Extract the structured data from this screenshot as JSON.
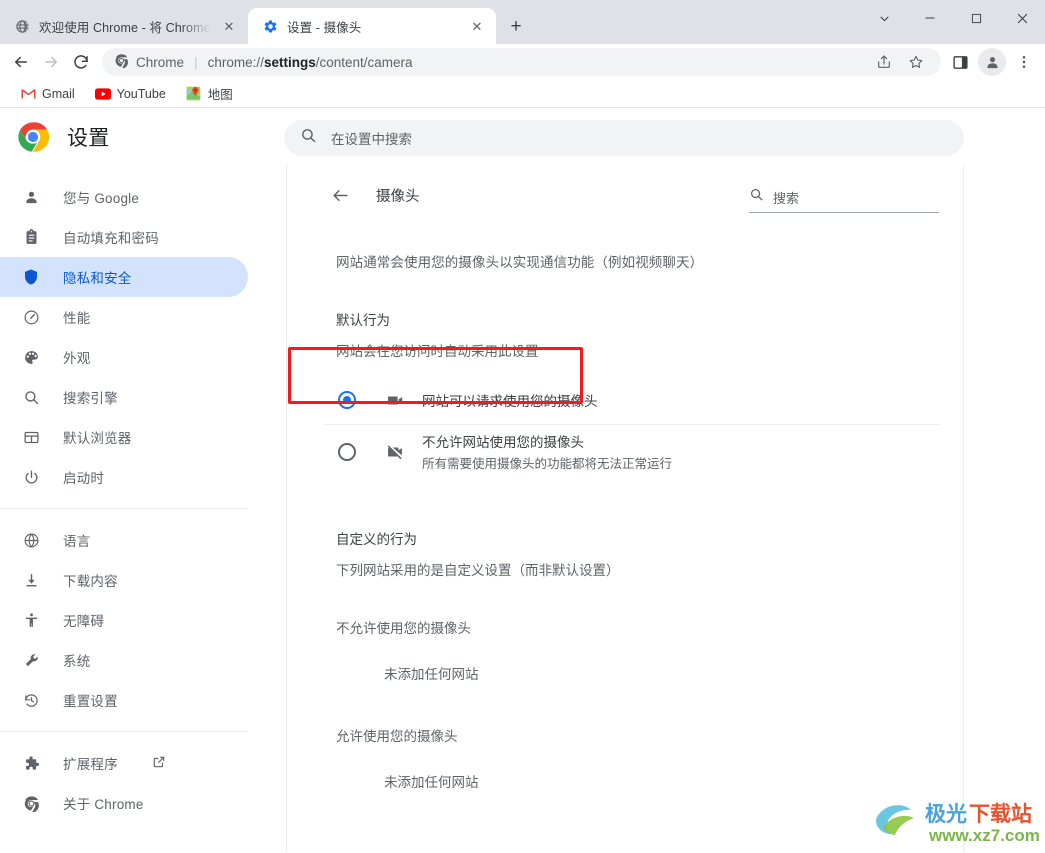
{
  "window": {
    "controls": [
      {
        "name": "tab-search-button",
        "glyph": "⌄"
      },
      {
        "name": "minimize-button",
        "glyph": "—"
      },
      {
        "name": "maximize-button",
        "glyph": "□"
      },
      {
        "name": "close-button",
        "glyph": "✕"
      }
    ]
  },
  "tabs": [
    {
      "title": "欢迎使用 Chrome - 将 Chrome",
      "favicon": "globe-icon",
      "active": false,
      "close_label": "✕"
    },
    {
      "title": "设置 - 摄像头",
      "favicon": "gear-icon",
      "active": true,
      "close_label": "✕"
    }
  ],
  "new_tab_label": "+",
  "toolbar": {
    "back_label": "←",
    "forward_label": "→",
    "reload_label": "⟳",
    "omnibox": {
      "chip_label": "Chrome",
      "separator": "|",
      "url_prefix": "chrome://",
      "url_bold": "settings",
      "url_suffix": "/content/camera"
    },
    "share_name": "share-icon",
    "bookmark_name": "star-icon",
    "sidepanel_name": "side-panel-icon",
    "profile_name": "profile-avatar",
    "menu_name": "three-dot-menu-icon"
  },
  "bookmarks": [
    {
      "label": "Gmail",
      "icon": "gmail-icon"
    },
    {
      "label": "YouTube",
      "icon": "youtube-icon"
    },
    {
      "label": "地图",
      "icon": "google-maps-icon"
    }
  ],
  "settings_header": {
    "title": "设置",
    "logo": "chrome-logo",
    "search_placeholder": "在设置中搜索"
  },
  "sidebar": {
    "group1": [
      {
        "label": "您与 Google",
        "icon": "person-icon",
        "selected": false
      },
      {
        "label": "自动填充和密码",
        "icon": "clipboard-icon",
        "selected": false
      },
      {
        "label": "隐私和安全",
        "icon": "shield-icon",
        "selected": true
      },
      {
        "label": "性能",
        "icon": "speedometer-icon",
        "selected": false
      },
      {
        "label": "外观",
        "icon": "palette-icon",
        "selected": false
      },
      {
        "label": "搜索引擎",
        "icon": "search-icon",
        "selected": false
      },
      {
        "label": "默认浏览器",
        "icon": "browser-window-icon",
        "selected": false
      },
      {
        "label": "启动时",
        "icon": "power-icon",
        "selected": false
      }
    ],
    "group2": [
      {
        "label": "语言",
        "icon": "globe-icon",
        "selected": false
      },
      {
        "label": "下载内容",
        "icon": "download-icon",
        "selected": false
      },
      {
        "label": "无障碍",
        "icon": "accessibility-icon",
        "selected": false
      },
      {
        "label": "系统",
        "icon": "wrench-icon",
        "selected": false
      },
      {
        "label": "重置设置",
        "icon": "history-restore-icon",
        "selected": false
      }
    ],
    "group3": [
      {
        "label": "扩展程序",
        "icon": "puzzle-icon",
        "external": true,
        "selected": false
      },
      {
        "label": "关于 Chrome",
        "icon": "chrome-icon",
        "selected": false
      }
    ]
  },
  "content": {
    "back_label": "←",
    "title": "摄像头",
    "search_placeholder": "搜索",
    "description": "网站通常会使用您的摄像头以实现通信功能（例如视频聊天）",
    "default_behavior_label": "默认行为",
    "default_behavior_sub": "网站会在您访问时自动采用此设置",
    "options": [
      {
        "title": "网站可以请求使用您的摄像头",
        "subtitle": "",
        "icon": "videocam-icon",
        "selected": true,
        "highlighted": true
      },
      {
        "title": "不允许网站使用您的摄像头",
        "subtitle": "所有需要使用摄像头的功能都将无法正常运行",
        "icon": "videocam-off-icon",
        "selected": false,
        "highlighted": false
      }
    ],
    "custom_behavior_label": "自定义的行为",
    "custom_behavior_sub": "下列网站采用的是自定义设置（而非默认设置）",
    "custom_groups": [
      {
        "title": "不允许使用您的摄像头",
        "empty_text": "未添加任何网站"
      },
      {
        "title": "允许使用您的摄像头",
        "empty_text": "未添加任何网站"
      }
    ]
  },
  "watermark": {
    "title": "极光下载站",
    "url": "www.xz7.com"
  },
  "colors": {
    "accent_blue": "#1a73e8",
    "selected_nav_bg": "#d3e3fd",
    "selected_nav_text": "#0b57d0",
    "highlight_red": "#ee1c1c",
    "tabstrip_bg": "#dee1e6",
    "text_primary": "#202124",
    "text_secondary": "#5f6368"
  }
}
